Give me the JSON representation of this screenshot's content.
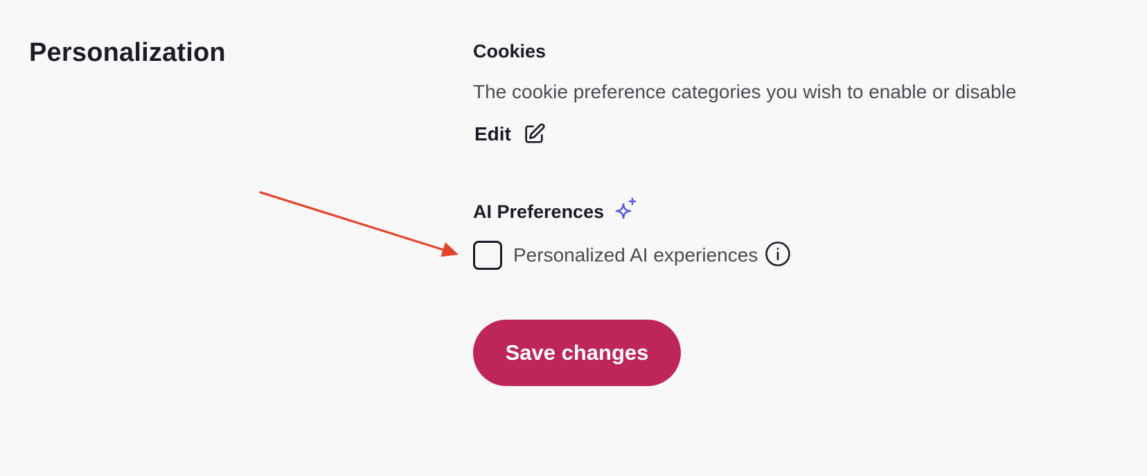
{
  "section": {
    "title": "Personalization"
  },
  "cookies": {
    "heading": "Cookies",
    "description": "The cookie preference categories you wish to enable or disable",
    "edit_label": "Edit",
    "edit_icon": "pencil-square-icon"
  },
  "ai_preferences": {
    "heading": "AI Preferences",
    "heading_icon": "sparkle-icon",
    "checkbox_label": "Personalized AI experiences",
    "checkbox_checked": false,
    "info_icon": "info-circle-icon"
  },
  "actions": {
    "save_label": "Save changes"
  },
  "colors": {
    "background": "#f8f8f8",
    "text_primary": "#1c1c28",
    "text_secondary": "#4a4a52",
    "accent_button": "#be2558",
    "sparkle": "#5a5ae6",
    "annotation_arrow": "#e5432a"
  }
}
